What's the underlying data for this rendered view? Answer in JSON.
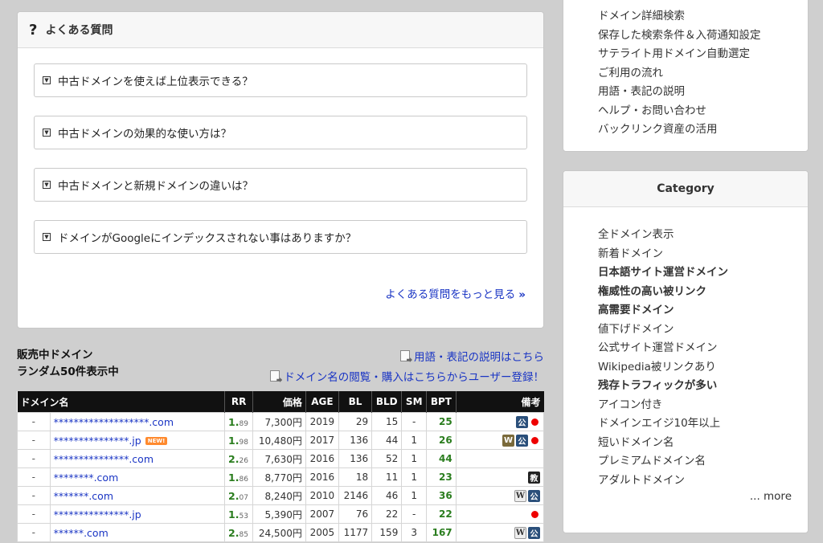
{
  "faq": {
    "title": "よくある質問",
    "items": [
      "中古ドメインを使えば上位表示できる？",
      "中古ドメインの効果的な使い方は？",
      "中古ドメインと新規ドメインの違いは？",
      "ドメインがGoogleにインデックスされない事はありますか？"
    ],
    "more": "よくある質問をもっと見る"
  },
  "sale": {
    "heading_line1": "販売中ドメイン",
    "heading_line2": "ランダム50件表示中",
    "link_terms": "用語・表記の説明はこちら",
    "link_register": "ドメイン名の閲覧・購入はこちらからユーザー登録！",
    "columns": [
      "ドメイン名",
      "RR",
      "価格",
      "AGE",
      "BL",
      "BLD",
      "SM",
      "BPT",
      "備考"
    ],
    "rows": [
      {
        "dash": "-",
        "name": "*******************.com",
        "rr_main": "1.",
        "rr_sub": "89",
        "price": "7,300円",
        "age": "2019",
        "bl": "29",
        "bld": "15",
        "sm": "-",
        "bpt": "25"
      },
      {
        "dash": "-",
        "name": "***************.jp",
        "new": "NEW!",
        "rr_main": "1.",
        "rr_sub": "98",
        "price": "10,480円",
        "age": "2017",
        "bl": "136",
        "bld": "44",
        "sm": "1",
        "bpt": "26"
      },
      {
        "dash": "-",
        "name": "***************.com",
        "rr_main": "2.",
        "rr_sub": "26",
        "price": "7,630円",
        "age": "2016",
        "bl": "136",
        "bld": "52",
        "sm": "1",
        "bpt": "44"
      },
      {
        "dash": "-",
        "name": "********.com",
        "rr_main": "1.",
        "rr_sub": "86",
        "price": "8,770円",
        "age": "2016",
        "bl": "18",
        "bld": "11",
        "sm": "1",
        "bpt": "23"
      },
      {
        "dash": "-",
        "name": "*******.com",
        "rr_main": "2.",
        "rr_sub": "07",
        "price": "8,240円",
        "age": "2010",
        "bl": "2146",
        "bld": "46",
        "sm": "1",
        "bpt": "36"
      },
      {
        "dash": "-",
        "name": "***************.jp",
        "rr_main": "1.",
        "rr_sub": "53",
        "price": "5,390円",
        "age": "2007",
        "bl": "76",
        "bld": "22",
        "sm": "-",
        "bpt": "22"
      },
      {
        "dash": "-",
        "name": "******.com",
        "rr_main": "2.",
        "rr_sub": "85",
        "price": "24,500円",
        "age": "2005",
        "bl": "1177",
        "bld": "159",
        "sm": "3",
        "bpt": "167"
      }
    ],
    "icons": {
      "official": "公",
      "edu": "教",
      "wiki": "W",
      "web": "W"
    }
  },
  "side_menu": [
    "ドメイン詳細検索",
    "保存した検索条件＆入荷通知設定",
    "サテライト用ドメイン自動選定",
    "ご利用の流れ",
    "用語・表記の説明",
    "ヘルプ・お問い合わせ",
    "バックリンク資産の活用"
  ],
  "category": {
    "title": "Category",
    "items": [
      "全ドメイン表示",
      "新着ドメイン",
      "日本語サイト運営ドメイン",
      "権威性の高い被リンク",
      "高需要ドメイン",
      "値下げドメイン",
      "公式サイト運営ドメイン",
      "Wikipedia被リンクあり",
      "残存トラフィックが多い",
      "アイコン付き",
      "ドメインエイジ10年以上",
      "短いドメイン名",
      "プレミアムドメイン名",
      "アダルトドメイン"
    ],
    "more": "... more"
  }
}
